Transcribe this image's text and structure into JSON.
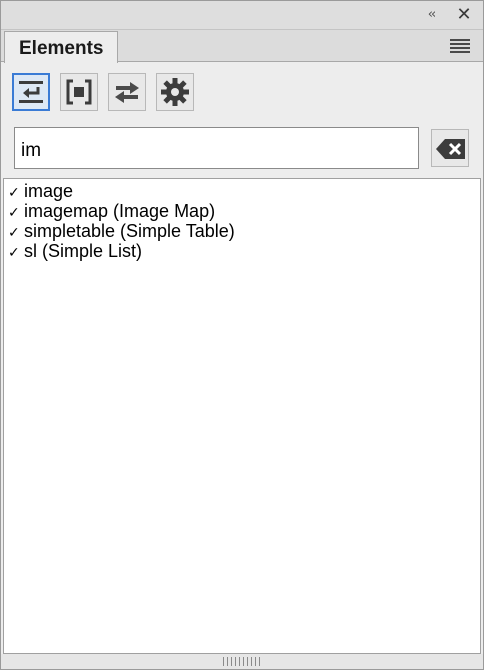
{
  "panel": {
    "title_tab": "Elements",
    "collapse_glyph": "‹‹",
    "close_glyph": "✕",
    "menu_icon": "hamburger-menu-icon"
  },
  "toolbar": {
    "buttons": [
      {
        "icon": "insert-element-icon",
        "active": true
      },
      {
        "icon": "wrap-element-icon",
        "active": false
      },
      {
        "icon": "swap-element-icon",
        "active": false
      },
      {
        "icon": "settings-gear-icon",
        "active": false
      }
    ]
  },
  "search": {
    "value": "im",
    "clear_icon": "clear-backspace-icon"
  },
  "results": [
    {
      "check": "✓",
      "label": "image"
    },
    {
      "check": "✓",
      "label": "imagemap  (Image Map)"
    },
    {
      "check": "✓",
      "label": "simpletable  (Simple Table)"
    },
    {
      "check": "✓",
      "label": "sl  (Simple List)"
    }
  ],
  "colors": {
    "accent": "#3a7bd5",
    "panel_bg": "#ededed",
    "list_bg": "#ffffff"
  }
}
